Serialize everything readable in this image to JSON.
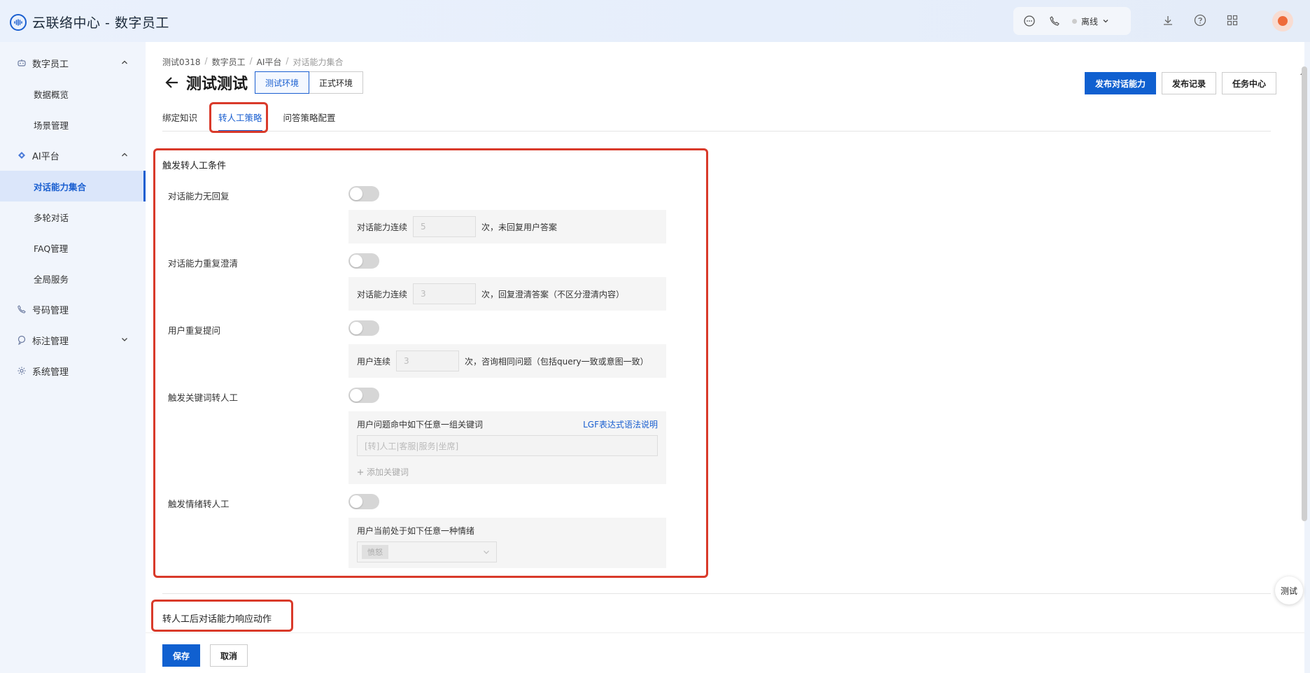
{
  "app": {
    "title": "云联络中心 - 数字员工"
  },
  "topbar": {
    "status_label": "离线",
    "icons": [
      "chat-icon",
      "phone-icon",
      "download-icon",
      "help-icon",
      "grid-icon"
    ]
  },
  "sidebar": {
    "groups": [
      {
        "label": "数字员工",
        "icon": "robot-icon",
        "expanded": true
      },
      {
        "label": "AI平台",
        "icon": "ai-icon",
        "expanded": true
      },
      {
        "label": "号码管理",
        "icon": "phone-icon"
      },
      {
        "label": "标注管理",
        "icon": "tag-icon",
        "expanded": false
      },
      {
        "label": "系统管理",
        "icon": "gear-icon"
      }
    ],
    "items": [
      {
        "label": "数据概览"
      },
      {
        "label": "场景管理"
      },
      {
        "label": "对话能力集合"
      },
      {
        "label": "多轮对话"
      },
      {
        "label": "FAQ管理"
      },
      {
        "label": "全局服务"
      }
    ]
  },
  "breadcrumb": [
    "测试0318",
    "数字员工",
    "AI平台",
    "对话能力集合"
  ],
  "header": {
    "title": "测试测试",
    "env_test": "测试环境",
    "env_prod": "正式环境",
    "publish": "发布对话能力",
    "publish_log": "发布记录",
    "task_center": "任务中心"
  },
  "tabs": [
    "绑定知识",
    "转人工策略",
    "问答策略配置"
  ],
  "trigger": {
    "title": "触发转人工条件",
    "no_reply": {
      "label": "对话能力无回复",
      "enabled": false,
      "prefix": "对话能力连续",
      "value": "5",
      "suffix": "次，未回复用户答案"
    },
    "repeat_clarify": {
      "label": "对话能力重复澄清",
      "enabled": false,
      "prefix": "对话能力连续",
      "value": "3",
      "suffix": "次，回复澄清答案（不区分澄清内容）"
    },
    "repeat_question": {
      "label": "用户重复提问",
      "enabled": false,
      "prefix": "用户连续",
      "value": "3",
      "suffix": "次，咨询相同问题（包括query一致或意图一致）"
    },
    "keyword": {
      "label": "触发关键词转人工",
      "enabled": false,
      "desc": "用户问题命中如下任意一组关键词",
      "link": "LGF表达式语法说明",
      "placeholder": "[转]人工|客服|服务|坐席]",
      "add_label": "添加关键词"
    },
    "emotion": {
      "label": "触发情绪转人工",
      "enabled": false,
      "desc": "用户当前处于如下任意一种情绪",
      "selected": "愤怒"
    }
  },
  "response": {
    "title": "转人工后对话能力响应动作"
  },
  "footer": {
    "save": "保存",
    "cancel": "取消"
  },
  "float_test": "测试"
}
